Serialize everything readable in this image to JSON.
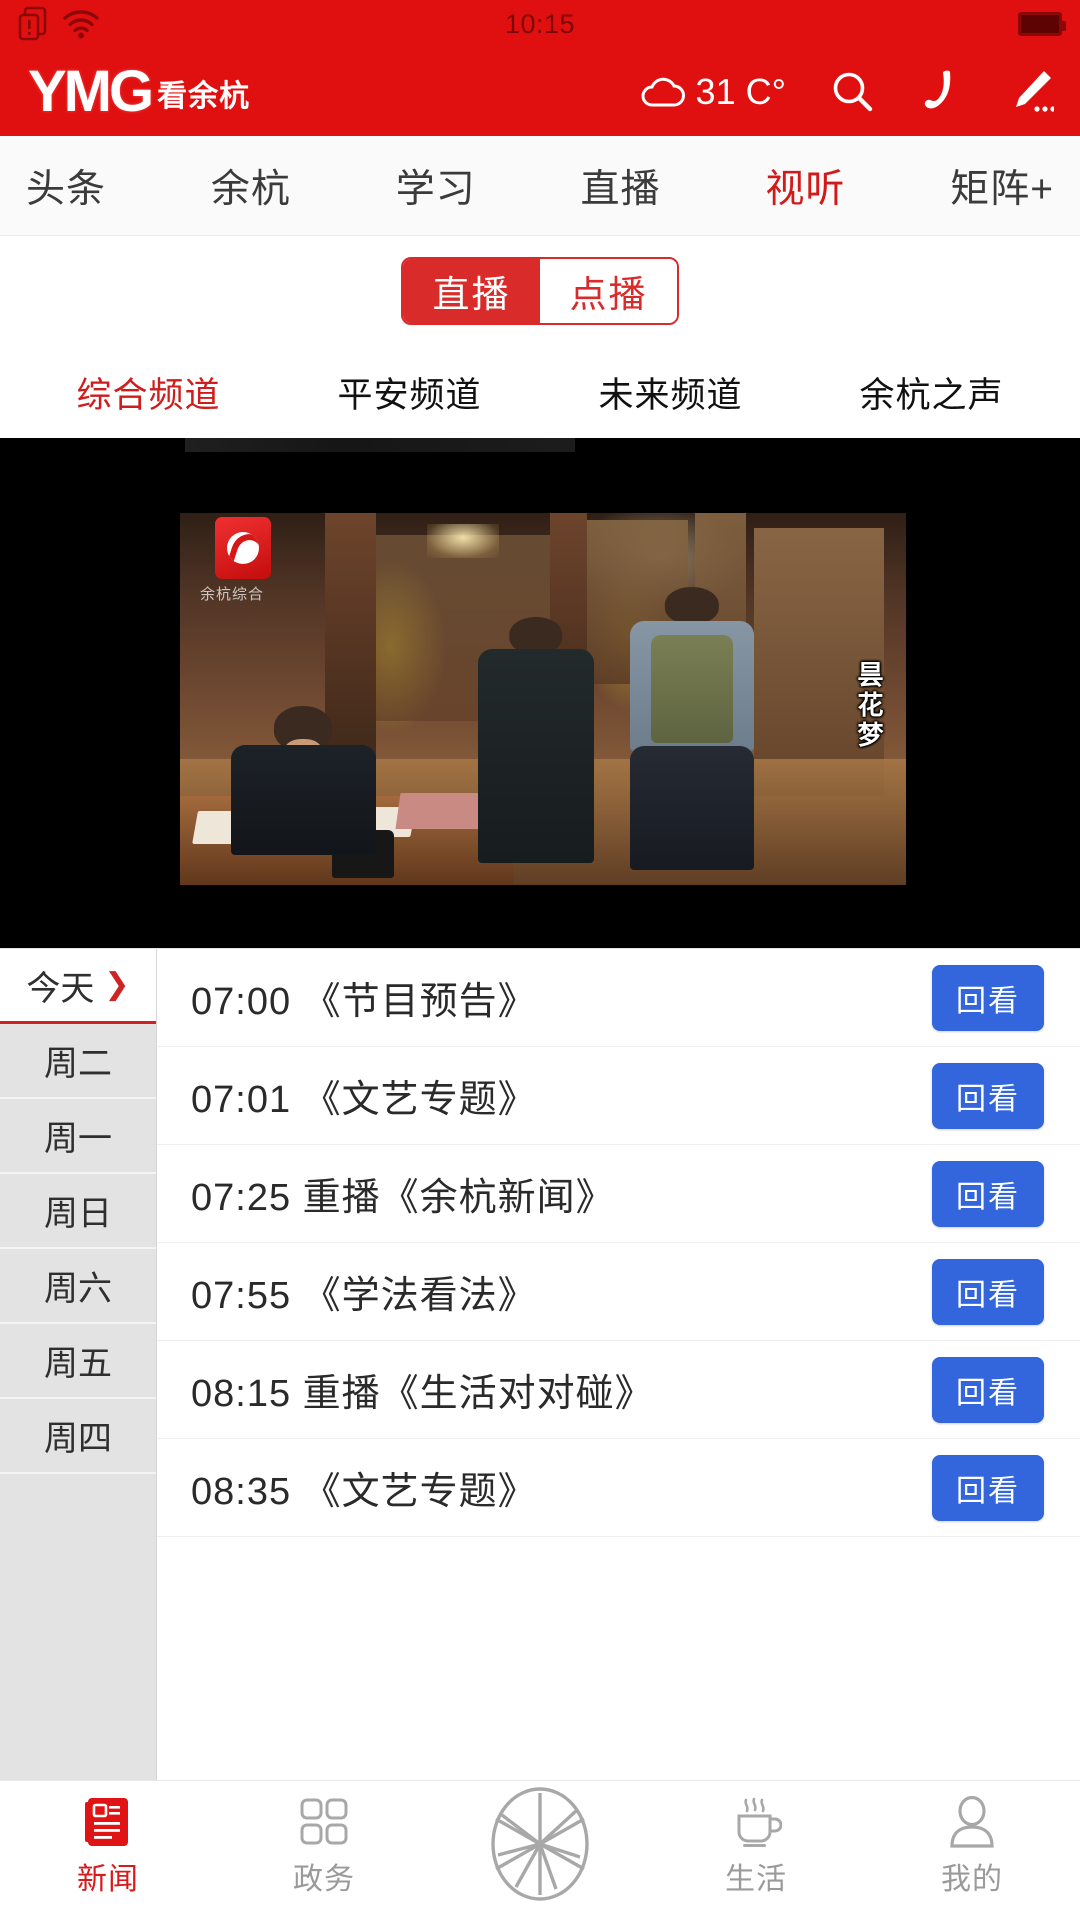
{
  "status_bar": {
    "time": "10:15",
    "icons": [
      "sim-card-alert-icon",
      "wifi-icon",
      "battery-icon"
    ]
  },
  "header": {
    "logo": "YMG",
    "logo_sub": "看余杭",
    "weather": {
      "icon": "cloud-icon",
      "temperature": "31 C°"
    },
    "actions": [
      {
        "name": "search-icon",
        "label": "搜索"
      },
      {
        "name": "phone-icon",
        "label": "电话"
      },
      {
        "name": "edit-icon",
        "label": "爆料"
      }
    ]
  },
  "main_tabs": [
    {
      "label": "头条",
      "active": false
    },
    {
      "label": "余杭",
      "active": false
    },
    {
      "label": "学习",
      "active": false
    },
    {
      "label": "直播",
      "active": false
    },
    {
      "label": "视听",
      "active": true
    },
    {
      "label": "矩阵+",
      "active": false
    }
  ],
  "segment": {
    "live_label": "直播",
    "vod_label": "点播",
    "selected": "直播"
  },
  "channel_tabs": [
    {
      "label": "综合频道",
      "active": true
    },
    {
      "label": "平安频道",
      "active": false
    },
    {
      "label": "未来频道",
      "active": false
    },
    {
      "label": "余杭之声",
      "active": false
    }
  ],
  "player": {
    "channel_logo_caption": "余杭综合",
    "show_title": "昙花梦"
  },
  "days": [
    {
      "label": "今天",
      "active": true,
      "chevron": "❯"
    },
    {
      "label": "周二",
      "active": false
    },
    {
      "label": "周一",
      "active": false
    },
    {
      "label": "周日",
      "active": false
    },
    {
      "label": "周六",
      "active": false
    },
    {
      "label": "周五",
      "active": false
    },
    {
      "label": "周四",
      "active": false
    }
  ],
  "programs": [
    {
      "text": "07:00 《节目预告》",
      "action": "回看"
    },
    {
      "text": "07:01 《文艺专题》",
      "action": "回看"
    },
    {
      "text": "07:25 重播《余杭新闻》",
      "action": "回看"
    },
    {
      "text": "07:55 《学法看法》",
      "action": "回看"
    },
    {
      "text": "08:15 重播《生活对对碰》",
      "action": "回看"
    },
    {
      "text": "08:35 《文艺专题》",
      "action": "回看"
    }
  ],
  "bottom_nav": [
    {
      "label": "新闻",
      "icon": "newspaper-icon",
      "active": true
    },
    {
      "label": "政务",
      "icon": "grid-icon",
      "active": false
    },
    {
      "label": "",
      "icon": "camera-shutter-icon",
      "active": false
    },
    {
      "label": "生活",
      "icon": "coffee-cup-icon",
      "active": false
    },
    {
      "label": "我的",
      "icon": "person-icon",
      "active": false
    }
  ],
  "colors": {
    "brand_red": "#e11010",
    "accent_red": "#cf1c1c",
    "replay_blue": "#3366dd",
    "day_inactive_bg": "#e3e3e3"
  }
}
